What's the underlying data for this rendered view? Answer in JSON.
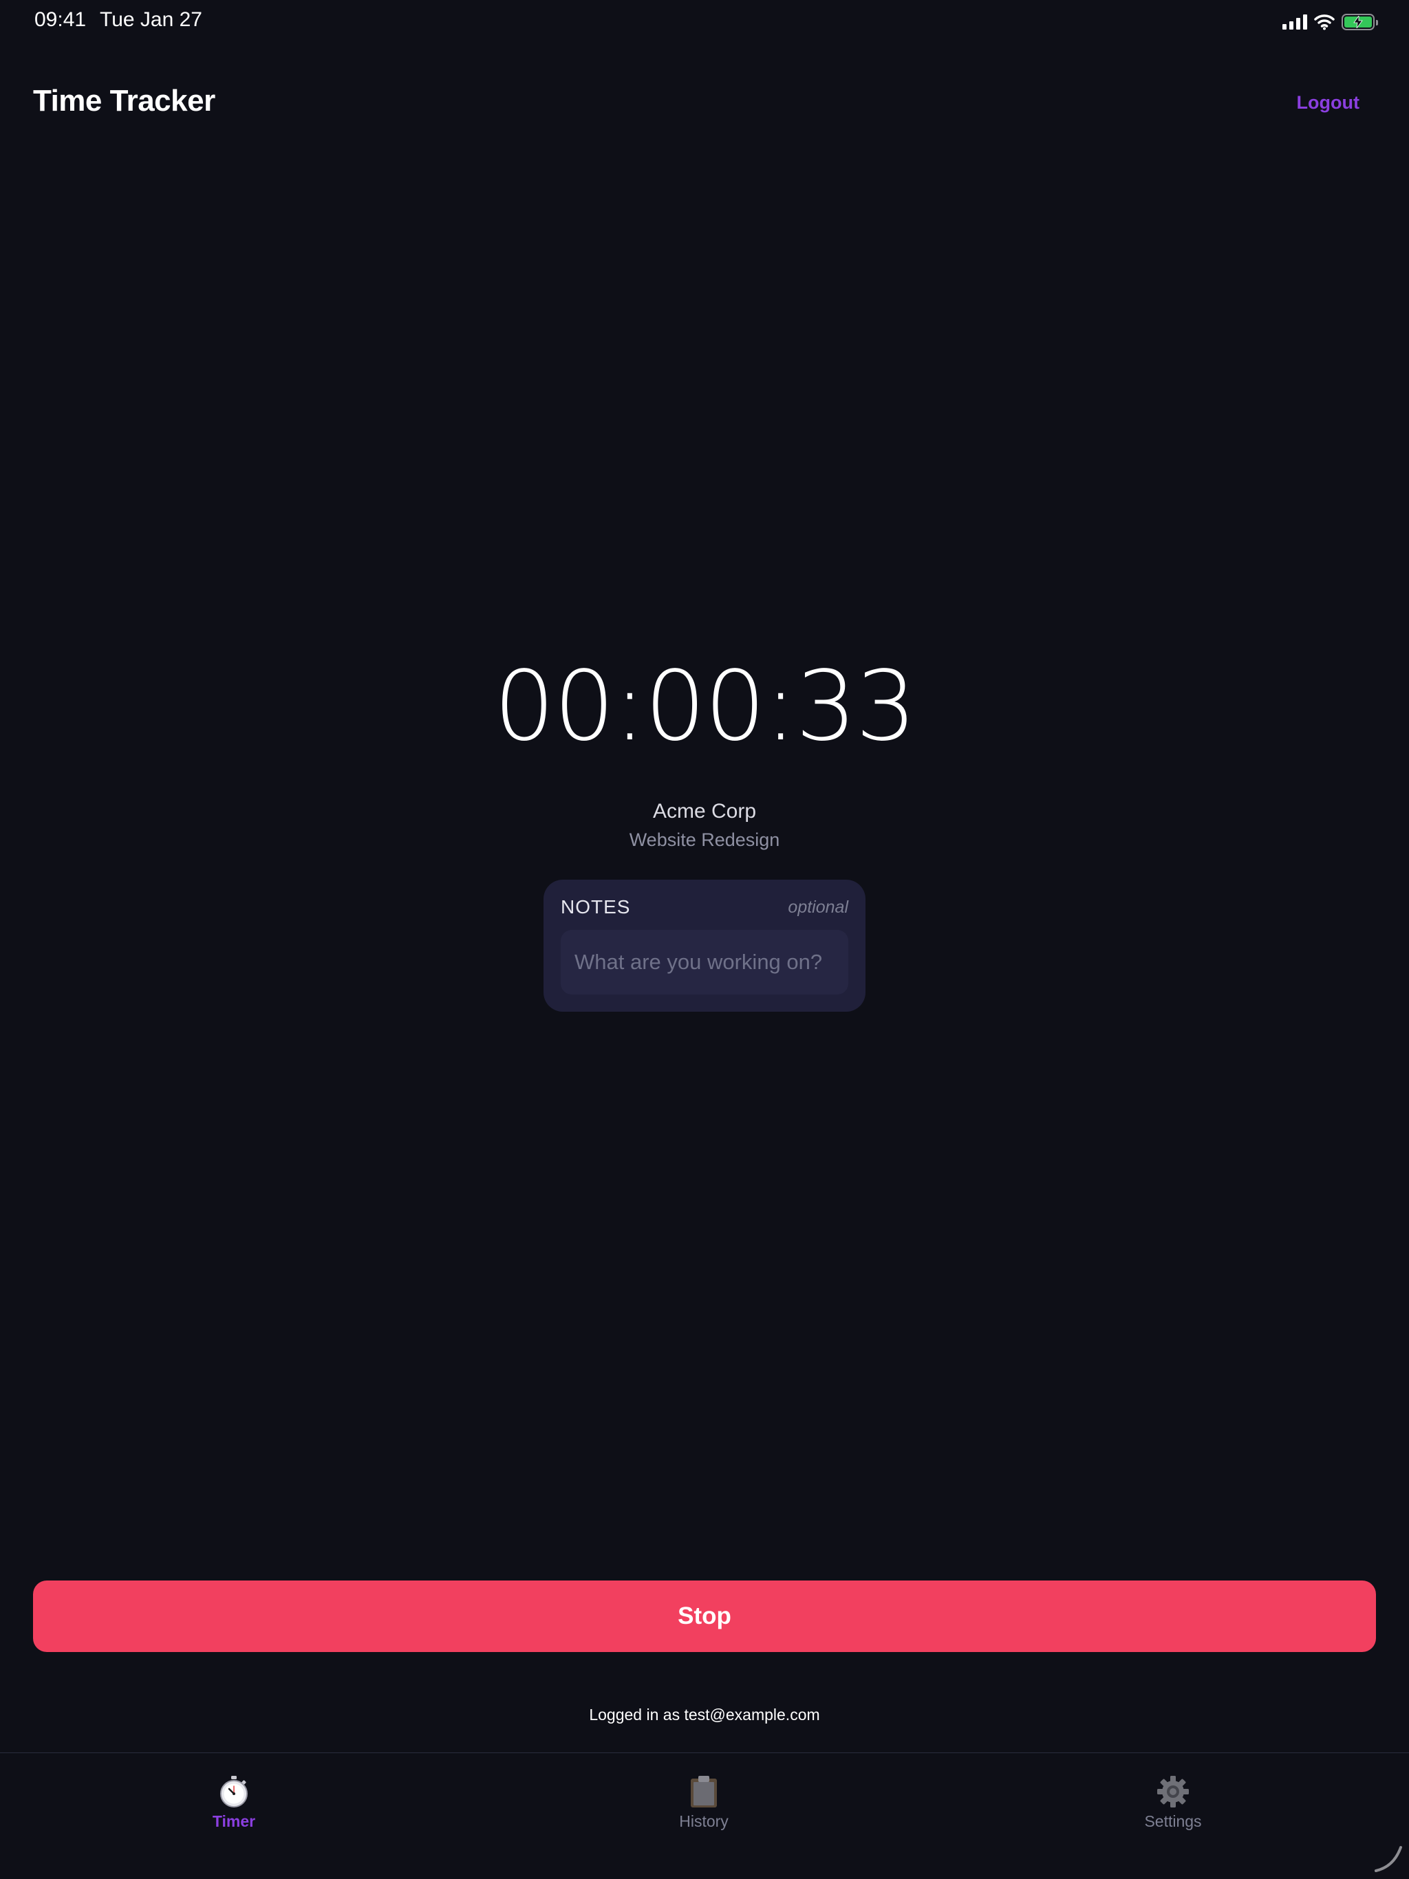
{
  "status_bar": {
    "time": "09:41",
    "date": "Tue Jan 27",
    "icons": [
      "cellular-signal-icon",
      "wifi-icon",
      "battery-charging-icon"
    ]
  },
  "header": {
    "title": "Time Tracker",
    "logout_label": "Logout"
  },
  "timer": {
    "display": "00:00:33",
    "client": "Acme Corp",
    "project": "Website Redesign"
  },
  "notes": {
    "label": "NOTES",
    "optional_label": "optional",
    "placeholder": "What are you working on?",
    "value": ""
  },
  "actions": {
    "stop_label": "Stop"
  },
  "footer": {
    "logged_in_text": "Logged in as test@example.com"
  },
  "tab_bar": {
    "tabs": [
      {
        "label": "Timer",
        "icon": "stopwatch-icon",
        "active": true
      },
      {
        "label": "History",
        "icon": "clipboard-icon",
        "active": false
      },
      {
        "label": "Settings",
        "icon": "gear-icon",
        "active": false
      }
    ]
  },
  "colors": {
    "background": "#0e0f17",
    "accent": "#8b3fe0",
    "stop_button": "#f2405f",
    "card": "#20203a",
    "battery_green": "#34c759"
  }
}
